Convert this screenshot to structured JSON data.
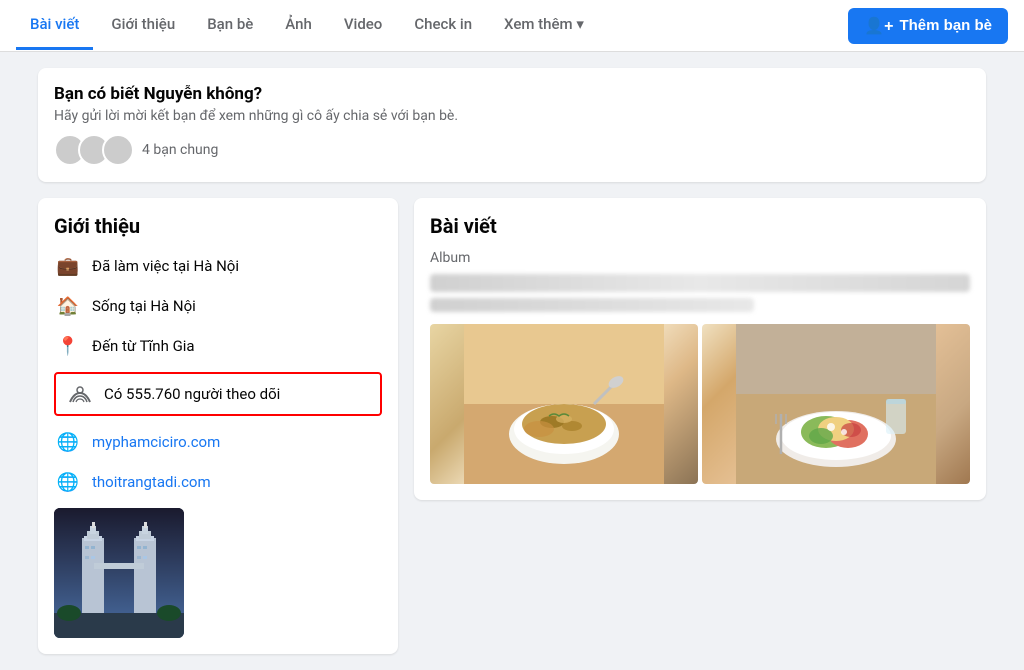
{
  "nav": {
    "tabs": [
      {
        "label": "Bài viết",
        "active": true
      },
      {
        "label": "Giới thiệu",
        "active": false
      },
      {
        "label": "Bạn bè",
        "active": false
      },
      {
        "label": "Ảnh",
        "active": false
      },
      {
        "label": "Video",
        "active": false
      },
      {
        "label": "Check in",
        "active": false
      },
      {
        "label": "Xem thêm ▾",
        "active": false
      }
    ],
    "add_friend_btn": "Thêm bạn bè"
  },
  "know_card": {
    "title": "Bạn có biết Nguyễn không?",
    "subtitle": "Hãy gửi lời mời kết bạn để xem những gì cô ấy chia sẻ với bạn bè.",
    "mutual_count": "4 bạn chung"
  },
  "intro": {
    "title": "Giới thiệu",
    "items": [
      {
        "icon": "💼",
        "text": "Đã làm việc tại Hà Nội"
      },
      {
        "icon": "🏠",
        "text": "Sống tại Hà Nội"
      },
      {
        "icon": "📍",
        "text": "Đến từ Tĩnh Gia"
      },
      {
        "icon": "📶",
        "text": "Có 555.760 người theo dõi",
        "highlight": true
      },
      {
        "icon": "🌐",
        "text": "myphamciciro.com",
        "link": true
      },
      {
        "icon": "🌐",
        "text": "thoitrangtadi.com",
        "link": true
      }
    ]
  },
  "posts": {
    "title": "Bài viết",
    "album_label": "Album"
  }
}
